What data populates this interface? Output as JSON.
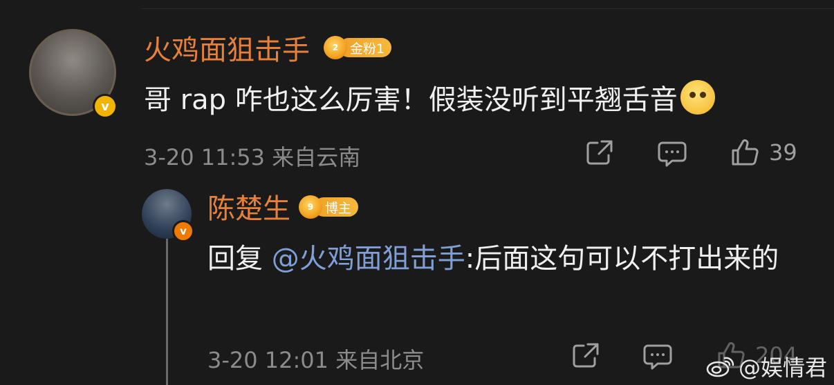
{
  "comment": {
    "username": "火鸡面狙击手",
    "fan_badge": {
      "level": "2",
      "label": "金粉1"
    },
    "text": "哥 rap 咋也这么厉害！假装没听到平翘舌音",
    "emoji": "thinking-face-emoji",
    "timestamp": "3-20 11:53",
    "location": "来自云南",
    "like_count": "39",
    "verified_badge": "v"
  },
  "reply": {
    "username": "陈楚生",
    "fan_badge": {
      "level": "9",
      "label": "博主"
    },
    "prefix": "回复 ",
    "mention": "@火鸡面狙击手",
    "text": ":后面这句可以不打出来的",
    "timestamp": "3-20 12:01",
    "location": "来自北京",
    "like_count": "204",
    "verified_badge": "v"
  },
  "watermark": {
    "text": "@娱情君"
  },
  "colors": {
    "background": "#1a1a1a",
    "username": "#e6803a",
    "mention": "#7f9fd6",
    "meta": "#8c8c8c",
    "badge": "#f5b93b"
  },
  "icons": [
    "share-icon",
    "comment-icon",
    "like-icon",
    "weibo-logo-icon"
  ]
}
